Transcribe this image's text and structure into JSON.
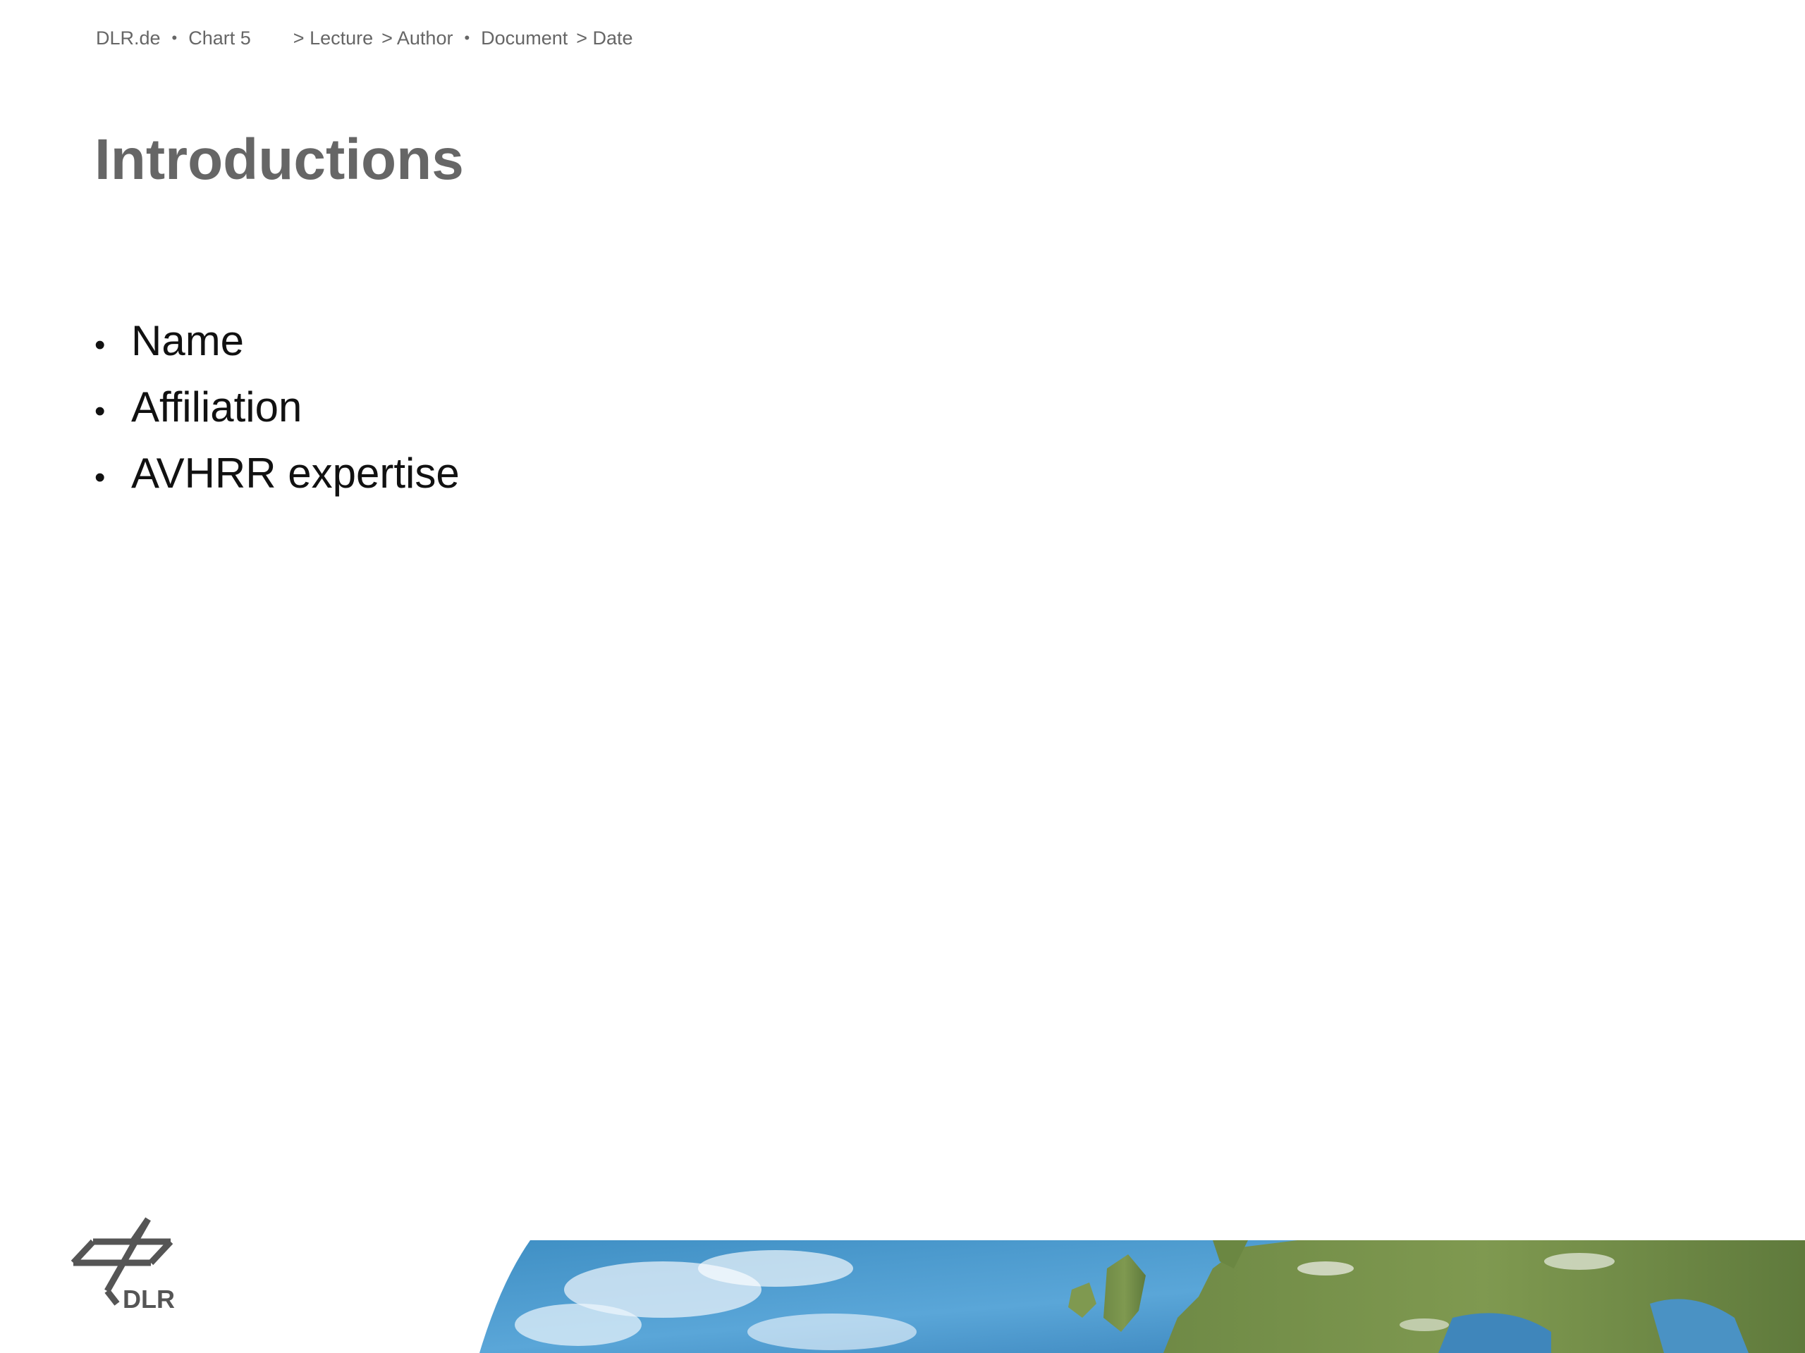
{
  "header": {
    "site": "DLR.de",
    "chart": "Chart 5",
    "crumb_lecture": "> Lecture",
    "crumb_author": "> Author",
    "crumb_document": "Document",
    "crumb_date": "> Date",
    "separator": "•"
  },
  "slide": {
    "title": "Introductions",
    "bullet_symbol": "•",
    "bullets": [
      {
        "text": "Name"
      },
      {
        "text": "Affiliation"
      },
      {
        "text": "AVHRR expertise"
      }
    ]
  },
  "footer": {
    "logo_text": "DLR",
    "logo_icon": "dlr-logo-icon",
    "banner_icon": "earth-banner-image"
  },
  "colors": {
    "header_text": "#666666",
    "title_text": "#666666",
    "body_text": "#111111",
    "logo": "#555555"
  }
}
